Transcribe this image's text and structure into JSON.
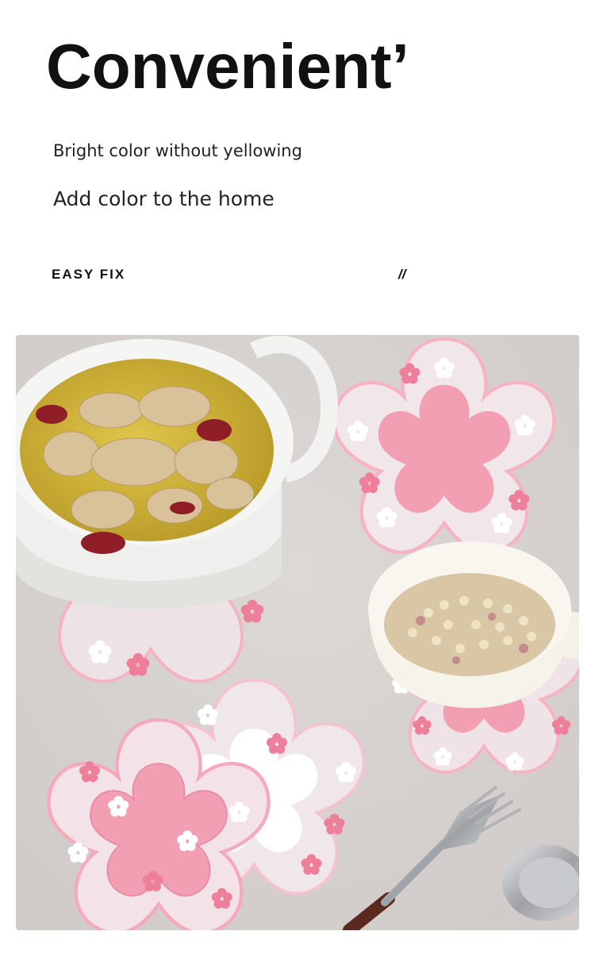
{
  "header": {
    "title": "Convenient’",
    "subtitle_primary": "Bright color without yellowing",
    "subtitle_secondary": "Add color to the home"
  },
  "feature": {
    "label": "EASY FIX",
    "divider_mark": "//"
  },
  "photo": {
    "subject": "cherry-blossom coasters with soup pot, cereal bowl, fork and spoon",
    "colors": {
      "table": "#d6d2cf",
      "coaster_pink": "#f2a6b8",
      "coaster_edge": "#f8c9d4",
      "pot": "#f4f4f2",
      "soup": "#d4b83a"
    }
  }
}
